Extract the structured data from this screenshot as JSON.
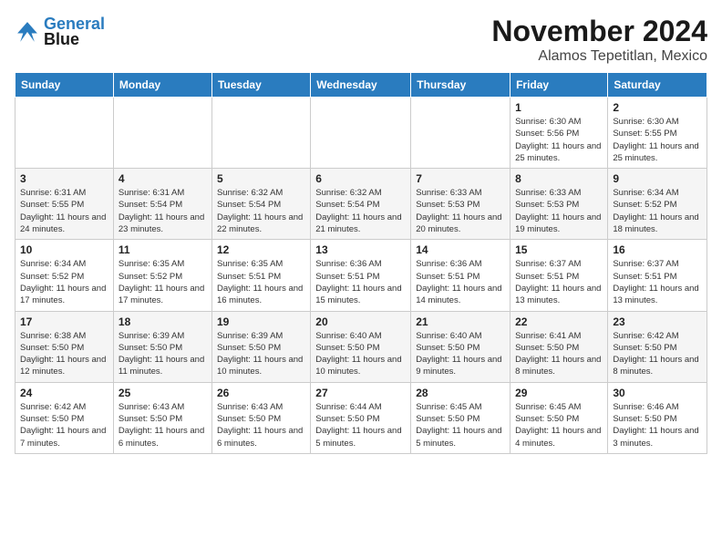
{
  "logo": {
    "line1": "General",
    "line2": "Blue"
  },
  "title": "November 2024",
  "location": "Alamos Tepetitlan, Mexico",
  "weekdays": [
    "Sunday",
    "Monday",
    "Tuesday",
    "Wednesday",
    "Thursday",
    "Friday",
    "Saturday"
  ],
  "weeks": [
    [
      {
        "day": "",
        "info": ""
      },
      {
        "day": "",
        "info": ""
      },
      {
        "day": "",
        "info": ""
      },
      {
        "day": "",
        "info": ""
      },
      {
        "day": "",
        "info": ""
      },
      {
        "day": "1",
        "info": "Sunrise: 6:30 AM\nSunset: 5:56 PM\nDaylight: 11 hours and 25 minutes."
      },
      {
        "day": "2",
        "info": "Sunrise: 6:30 AM\nSunset: 5:55 PM\nDaylight: 11 hours and 25 minutes."
      }
    ],
    [
      {
        "day": "3",
        "info": "Sunrise: 6:31 AM\nSunset: 5:55 PM\nDaylight: 11 hours and 24 minutes."
      },
      {
        "day": "4",
        "info": "Sunrise: 6:31 AM\nSunset: 5:54 PM\nDaylight: 11 hours and 23 minutes."
      },
      {
        "day": "5",
        "info": "Sunrise: 6:32 AM\nSunset: 5:54 PM\nDaylight: 11 hours and 22 minutes."
      },
      {
        "day": "6",
        "info": "Sunrise: 6:32 AM\nSunset: 5:54 PM\nDaylight: 11 hours and 21 minutes."
      },
      {
        "day": "7",
        "info": "Sunrise: 6:33 AM\nSunset: 5:53 PM\nDaylight: 11 hours and 20 minutes."
      },
      {
        "day": "8",
        "info": "Sunrise: 6:33 AM\nSunset: 5:53 PM\nDaylight: 11 hours and 19 minutes."
      },
      {
        "day": "9",
        "info": "Sunrise: 6:34 AM\nSunset: 5:52 PM\nDaylight: 11 hours and 18 minutes."
      }
    ],
    [
      {
        "day": "10",
        "info": "Sunrise: 6:34 AM\nSunset: 5:52 PM\nDaylight: 11 hours and 17 minutes."
      },
      {
        "day": "11",
        "info": "Sunrise: 6:35 AM\nSunset: 5:52 PM\nDaylight: 11 hours and 17 minutes."
      },
      {
        "day": "12",
        "info": "Sunrise: 6:35 AM\nSunset: 5:51 PM\nDaylight: 11 hours and 16 minutes."
      },
      {
        "day": "13",
        "info": "Sunrise: 6:36 AM\nSunset: 5:51 PM\nDaylight: 11 hours and 15 minutes."
      },
      {
        "day": "14",
        "info": "Sunrise: 6:36 AM\nSunset: 5:51 PM\nDaylight: 11 hours and 14 minutes."
      },
      {
        "day": "15",
        "info": "Sunrise: 6:37 AM\nSunset: 5:51 PM\nDaylight: 11 hours and 13 minutes."
      },
      {
        "day": "16",
        "info": "Sunrise: 6:37 AM\nSunset: 5:51 PM\nDaylight: 11 hours and 13 minutes."
      }
    ],
    [
      {
        "day": "17",
        "info": "Sunrise: 6:38 AM\nSunset: 5:50 PM\nDaylight: 11 hours and 12 minutes."
      },
      {
        "day": "18",
        "info": "Sunrise: 6:39 AM\nSunset: 5:50 PM\nDaylight: 11 hours and 11 minutes."
      },
      {
        "day": "19",
        "info": "Sunrise: 6:39 AM\nSunset: 5:50 PM\nDaylight: 11 hours and 10 minutes."
      },
      {
        "day": "20",
        "info": "Sunrise: 6:40 AM\nSunset: 5:50 PM\nDaylight: 11 hours and 10 minutes."
      },
      {
        "day": "21",
        "info": "Sunrise: 6:40 AM\nSunset: 5:50 PM\nDaylight: 11 hours and 9 minutes."
      },
      {
        "day": "22",
        "info": "Sunrise: 6:41 AM\nSunset: 5:50 PM\nDaylight: 11 hours and 8 minutes."
      },
      {
        "day": "23",
        "info": "Sunrise: 6:42 AM\nSunset: 5:50 PM\nDaylight: 11 hours and 8 minutes."
      }
    ],
    [
      {
        "day": "24",
        "info": "Sunrise: 6:42 AM\nSunset: 5:50 PM\nDaylight: 11 hours and 7 minutes."
      },
      {
        "day": "25",
        "info": "Sunrise: 6:43 AM\nSunset: 5:50 PM\nDaylight: 11 hours and 6 minutes."
      },
      {
        "day": "26",
        "info": "Sunrise: 6:43 AM\nSunset: 5:50 PM\nDaylight: 11 hours and 6 minutes."
      },
      {
        "day": "27",
        "info": "Sunrise: 6:44 AM\nSunset: 5:50 PM\nDaylight: 11 hours and 5 minutes."
      },
      {
        "day": "28",
        "info": "Sunrise: 6:45 AM\nSunset: 5:50 PM\nDaylight: 11 hours and 5 minutes."
      },
      {
        "day": "29",
        "info": "Sunrise: 6:45 AM\nSunset: 5:50 PM\nDaylight: 11 hours and 4 minutes."
      },
      {
        "day": "30",
        "info": "Sunrise: 6:46 AM\nSunset: 5:50 PM\nDaylight: 11 hours and 3 minutes."
      }
    ]
  ]
}
